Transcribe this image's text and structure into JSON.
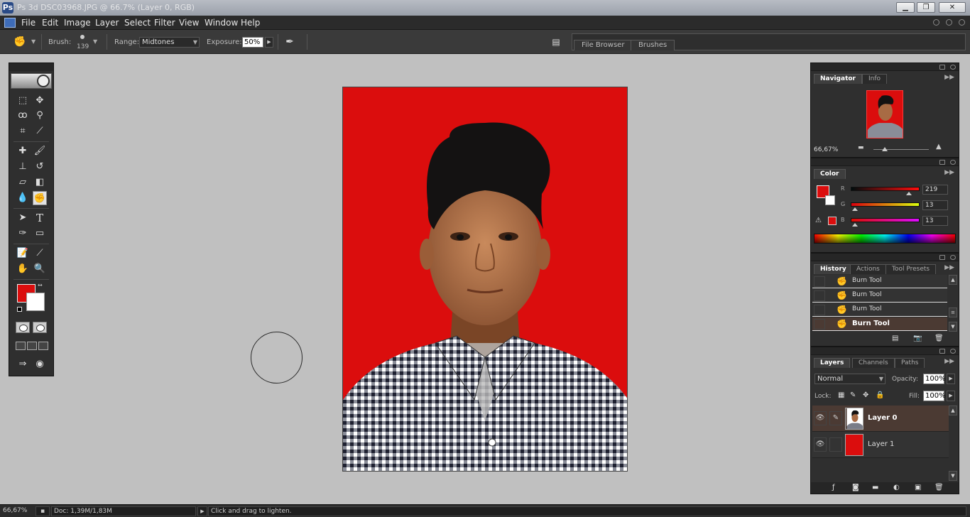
{
  "window": {
    "title": "Ps 3d DSC03968.JPG @ 66.7% (Layer 0, RGB)",
    "controls": [
      "minimize",
      "restore",
      "close"
    ]
  },
  "menu": [
    "File",
    "Edit",
    "Image",
    "Layer",
    "Select",
    "Filter",
    "View",
    "Window",
    "Help"
  ],
  "options": {
    "brush_label": "Brush:",
    "brush_size": "139",
    "range_label": "Range:",
    "range_value": "Midtones",
    "exposure_label": "Exposure:",
    "exposure_value": "50%",
    "palette_tabs": [
      "File Browser",
      "Brushes"
    ]
  },
  "toolbox": {
    "tools": [
      "marquee",
      "move",
      "lasso",
      "magic-wand",
      "crop",
      "slice",
      "healing-brush",
      "brush",
      "clone-stamp",
      "history-brush",
      "eraser",
      "gradient",
      "blur",
      "burn",
      "path-selection",
      "type",
      "pen",
      "rectangle",
      "notes",
      "eyedropper",
      "hand",
      "zoom"
    ],
    "active_tool": "burn",
    "foreground_color": "#db0d0d",
    "background_color": "#ffffff"
  },
  "navigator": {
    "tabs": [
      "Navigator",
      "Info"
    ],
    "zoom": "66,67%"
  },
  "color": {
    "tab": "Color",
    "r_label": "R",
    "r_value": "219",
    "g_label": "G",
    "g_value": "13",
    "b_label": "B",
    "b_value": "13"
  },
  "history": {
    "tabs": [
      "History",
      "Actions",
      "Tool Presets"
    ],
    "items": [
      "Burn Tool",
      "Burn Tool",
      "Burn Tool",
      "Burn Tool"
    ],
    "selected_index": 3
  },
  "layers": {
    "tabs": [
      "Layers",
      "Channels",
      "Paths"
    ],
    "blend_mode": "Normal",
    "opacity_label": "Opacity:",
    "opacity_value": "100%",
    "lock_label": "Lock:",
    "fill_label": "Fill:",
    "fill_value": "100%",
    "items": [
      {
        "name": "Layer 0",
        "selected": true
      },
      {
        "name": "Layer 1",
        "selected": false
      }
    ]
  },
  "status": {
    "zoom": "66,67%",
    "doc": "Doc: 1,39M/1,83M",
    "hint": "Click and drag to lighten."
  },
  "colors": {
    "photo_background": "#db0d0d",
    "selected_row": "#4b3a33"
  }
}
